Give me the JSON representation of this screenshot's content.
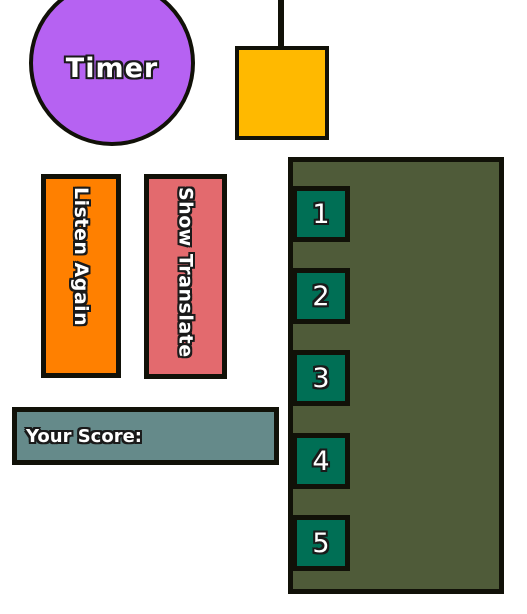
{
  "timer": {
    "label": "Timer",
    "color": "#b662f2"
  },
  "pendulum": {
    "color": "#ffb900"
  },
  "buttons": {
    "listen_again": {
      "label": "Listen Again",
      "color": "#ff8000"
    },
    "show_translate": {
      "label": "Show Translate",
      "color": "#e36a6e"
    }
  },
  "score": {
    "label": "Your Score:",
    "color": "#658a8a"
  },
  "choices": {
    "panel_color": "#4f5b39",
    "button_color": "#006f55",
    "items": [
      {
        "label": "1"
      },
      {
        "label": "2"
      },
      {
        "label": "3"
      },
      {
        "label": "4"
      },
      {
        "label": "5"
      }
    ]
  }
}
